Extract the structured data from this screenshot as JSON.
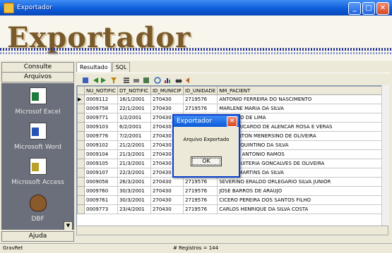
{
  "window": {
    "title": "Exportador",
    "minimize": "_",
    "maximize": "□",
    "close": "✕"
  },
  "banner": {
    "logo": "Exportador"
  },
  "left": {
    "consulte": "Consulte",
    "arquivos": "Arquivos",
    "apps": [
      {
        "label": "Microsof Excel",
        "icon": "excel-icon"
      },
      {
        "label": "Microsoft Word",
        "icon": "word-icon"
      },
      {
        "label": "Microsoft Access",
        "icon": "access-icon"
      },
      {
        "label": "DBF",
        "icon": "firefox-icon"
      }
    ],
    "ajuda": "Ajuda"
  },
  "tabs": [
    {
      "label": "Resultado"
    },
    {
      "label": "SQL"
    }
  ],
  "grid": {
    "columns": [
      "NU_NOTIFIC",
      "DT_NOTIFIC",
      "ID_MUNICIP",
      "ID_UNIDADE",
      "NM_PACIENT"
    ],
    "rows": [
      [
        "0009112",
        "16/1/2001",
        "270430",
        "2719576",
        "ANTONIO FERREIRA DO NASCIMENTO"
      ],
      [
        "0009758",
        "22/1/2001",
        "270430",
        "2719576",
        "MARLENE MARIA DA SILVA"
      ],
      [
        "0009771",
        "1/2/2001",
        "270430",
        "2719576",
        "MAURICIO DE LIMA"
      ],
      [
        "0009103",
        "6/2/2001",
        "270430",
        "2719576",
        "ANDRE RICARDO DE ALENCAR ROSA E VERAS"
      ],
      [
        "0009776",
        "7/2/2001",
        "270430",
        "2719576",
        "WELLINGTON MENERSINO DE OLIVEIRA"
      ],
      [
        "0009102",
        "21/2/2001",
        "270430",
        "2719576",
        "JAILSON QUINTINO DA SILVA"
      ],
      [
        "0009104",
        "21/3/2001",
        "270430",
        "2719576",
        "MARCOS ANTONIO RAMOS"
      ],
      [
        "0009105",
        "21/3/2001",
        "270430",
        "2719576",
        "MARIA QUITERIA GONCALVES DE OLIVEIRA"
      ],
      [
        "0009107",
        "22/3/2001",
        "270430",
        "2719576",
        "MIRIAN MARTINS DA SILVA"
      ],
      [
        "0009058",
        "26/3/2001",
        "270430",
        "2719576",
        "SEVERINO ERALDO ORLEGARIO SILVA JUNIOR"
      ],
      [
        "0009760",
        "30/3/2001",
        "270430",
        "2719576",
        "JOSE BARROS DE ARAUJO"
      ],
      [
        "0009761",
        "30/3/2001",
        "270430",
        "2719576",
        "CICERO PEREIRA DOS SANTOS FILHO"
      ],
      [
        "0009773",
        "23/4/2001",
        "270430",
        "2719576",
        "CARLOS HENRIQUE DA SILVA COSTA"
      ]
    ]
  },
  "status": {
    "left": "GravRet",
    "right": "# Registros = 144"
  },
  "dialog": {
    "title": "Exportador",
    "message": "Arquivo Exportado",
    "ok": "OK"
  },
  "colors": {
    "titlebar": "#0a5ad8",
    "panel": "#6b6f7b",
    "logo": "#7a5a2a"
  }
}
